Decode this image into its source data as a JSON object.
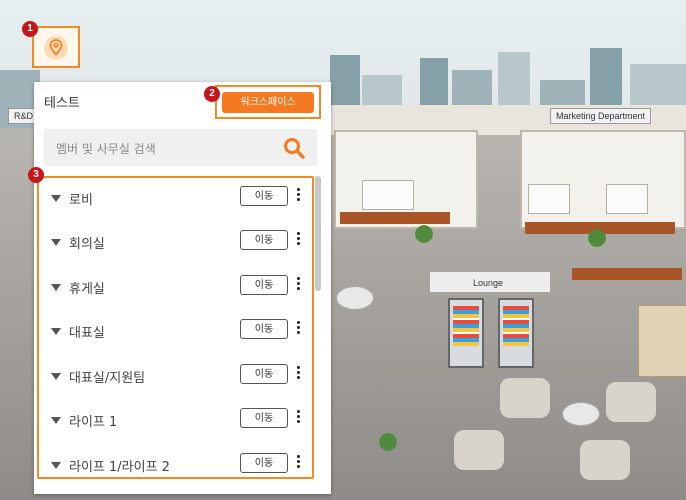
{
  "markers": {
    "one": "1",
    "two": "2",
    "three": "3"
  },
  "map_signs": {
    "rnd": "R&D",
    "marketing": "Marketing Department",
    "lounge": "Lounge"
  },
  "panel": {
    "title": "테스트",
    "workspace_button": "워크스페이스",
    "search_placeholder": "멤버 및 사무실 검색",
    "rooms": [
      {
        "label": "로비",
        "move": "이동"
      },
      {
        "label": "회의실",
        "move": "이동"
      },
      {
        "label": "휴게실",
        "move": "이동"
      },
      {
        "label": "대표실",
        "move": "이동"
      },
      {
        "label": "대표실/지원팀",
        "move": "이동"
      },
      {
        "label": "라이프 1",
        "move": "이동"
      },
      {
        "label": "라이프 1/라이프 2",
        "move": "이동"
      }
    ]
  },
  "colors": {
    "accent": "#f47920",
    "outline": "#f08a24",
    "badge": "#c4161c"
  },
  "icons": [
    "map-pin-icon",
    "search-icon",
    "caret-down-icon",
    "more-vertical-icon"
  ]
}
